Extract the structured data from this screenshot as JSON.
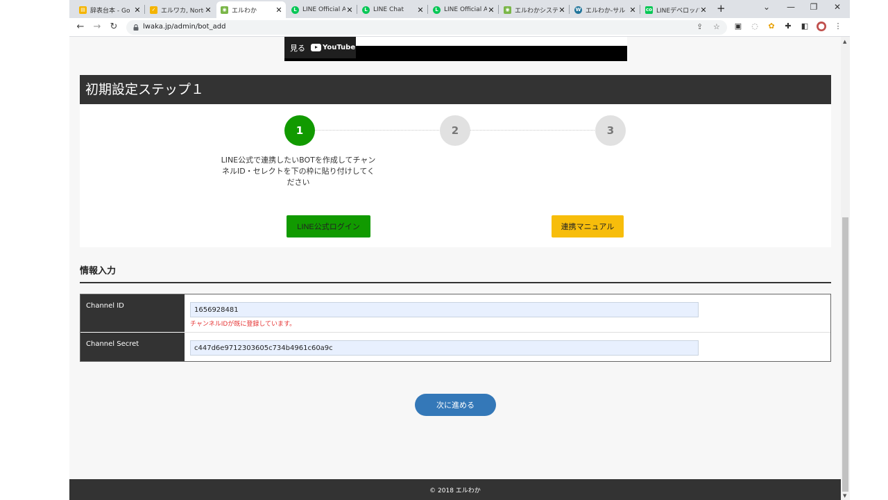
{
  "browser": {
    "tabs": [
      {
        "title": "辞表台本 - Go",
        "icon": "sheets-icon",
        "color": "#f4b400"
      },
      {
        "title": "エルワカ, Norte",
        "icon": "check-icon",
        "color": "#f4b400"
      },
      {
        "title": "エルわか",
        "icon": "erwaka-icon",
        "color": "#7ab648",
        "active": true
      },
      {
        "title": "LINE Official A",
        "icon": "line-icon",
        "color": "#06c755"
      },
      {
        "title": "LINE Chat",
        "icon": "line-icon",
        "color": "#06c755"
      },
      {
        "title": "LINE Official A",
        "icon": "line-icon",
        "color": "#06c755"
      },
      {
        "title": "エルわかシステ",
        "icon": "erwaka-icon",
        "color": "#7ab648"
      },
      {
        "title": "エルわか-サル",
        "icon": "wordpress-icon",
        "color": "#21759b"
      },
      {
        "title": "LINEデベロッパ",
        "icon": "line-dev-icon",
        "color": "#06c755"
      }
    ],
    "url": "lwaka.jp/admin/bot_add"
  },
  "video": {
    "watch_label": "見る",
    "youtube_label": "YouTube"
  },
  "step": {
    "header": "初期設定ステップ１",
    "circles": [
      "1",
      "2",
      "3"
    ],
    "description": "LINE公式で連携したいBOTを作成してチャンネルID・セレクトを下の枠に貼り付けしてください",
    "line_login_label": "LINE公式ログイン",
    "manual_label": "連携マニュアル"
  },
  "info": {
    "title": "情報入力",
    "channel_id_label": "Channel ID",
    "channel_id_value": "1656928481",
    "channel_id_error": "チャンネルIDが既に登録しています。",
    "channel_secret_label": "Channel Secret",
    "channel_secret_value": "c447d6e9712303605c734b4961c60a9c"
  },
  "next_label": "次に進める",
  "footer": "© 2018 エルわか",
  "colors": {
    "header_dark": "#333333",
    "step_active": "#119a00",
    "line_button": "#119a00",
    "manual_button": "#f7bd0b",
    "next_button": "#3478b8",
    "error": "#e53232"
  }
}
